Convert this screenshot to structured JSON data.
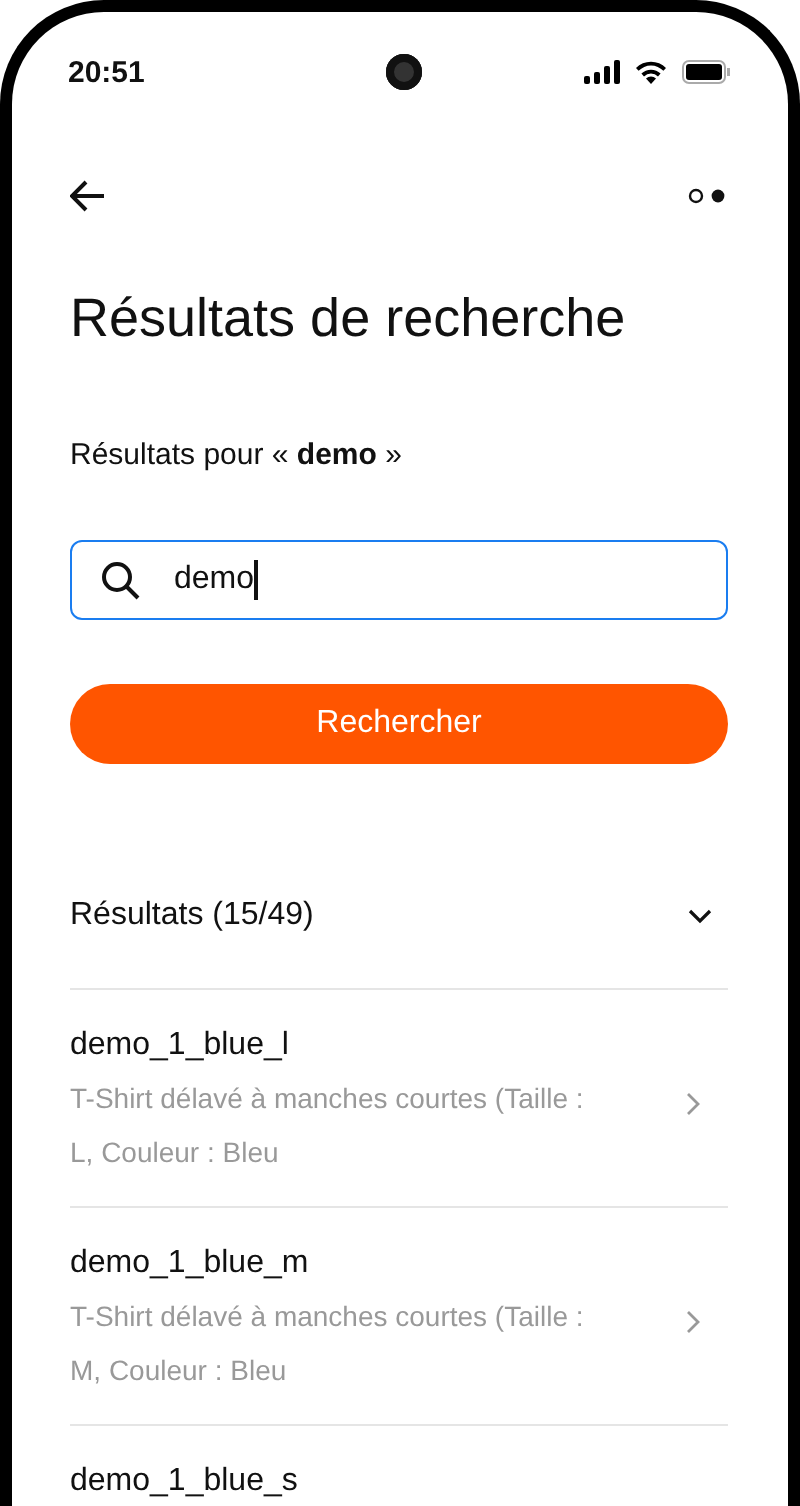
{
  "status_bar": {
    "time": "20:51"
  },
  "title": "Résultats de recherche",
  "subtitle": "Résultats pour « **demo** »",
  "search": {
    "value": "demo",
    "focused": true
  },
  "search_button": "Rechercher",
  "results": {
    "header": "Résultats (15/49)",
    "expanded": true,
    "items": [
      {
        "name": "demo_1_blue_l",
        "description": "T-Shirt délavé à manches courtes (Taille : L, Couleur : Bleu"
      },
      {
        "name": "demo_1_blue_m",
        "description": "T-Shirt délavé à manches courtes (Taille : M, Couleur : Bleu"
      },
      {
        "name": "demo_1_blue_s"
      }
    ]
  }
}
